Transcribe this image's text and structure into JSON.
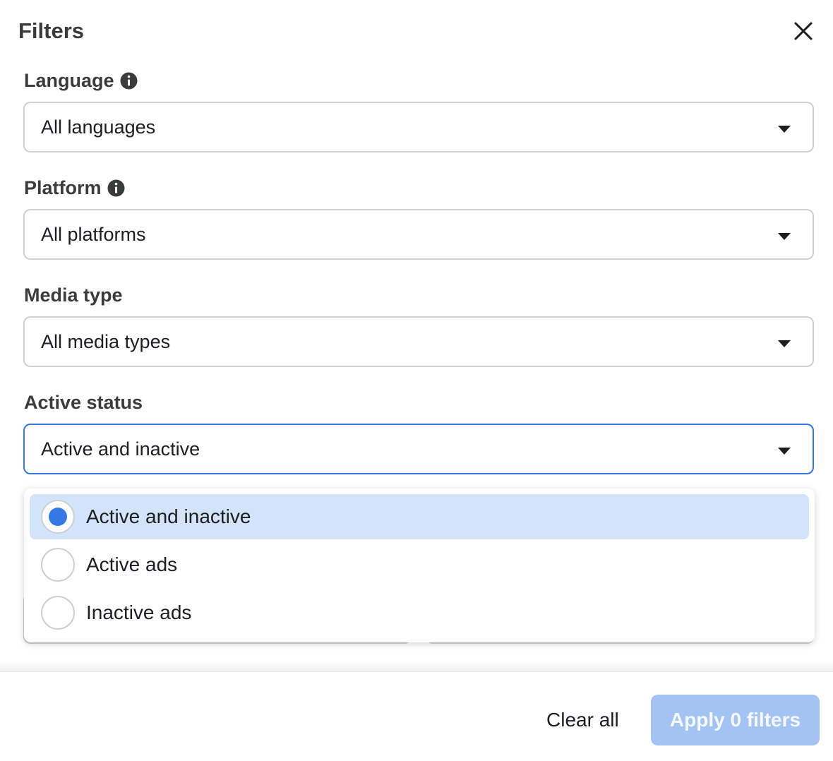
{
  "modal": {
    "title": "Filters",
    "close_icon": "close-icon"
  },
  "fields": {
    "language": {
      "label": "Language",
      "value": "All languages",
      "info_icon": "info-icon"
    },
    "platform": {
      "label": "Platform",
      "value": "All platforms",
      "info_icon": "info-icon"
    },
    "media_type": {
      "label": "Media type",
      "value": "All media types"
    },
    "active_status": {
      "label": "Active status",
      "value": "Active and inactive"
    }
  },
  "dropdown": {
    "options": [
      {
        "label": "Active and inactive",
        "selected": true
      },
      {
        "label": "Active ads",
        "selected": false
      },
      {
        "label": "Inactive ads",
        "selected": false
      }
    ]
  },
  "footer": {
    "clear_label": "Clear all",
    "apply_label": "Apply 0 filters"
  },
  "colors": {
    "accent": "#3578e5",
    "selected_option_bg": "#d3e3f9",
    "apply_disabled_bg": "#a3c4f3"
  }
}
